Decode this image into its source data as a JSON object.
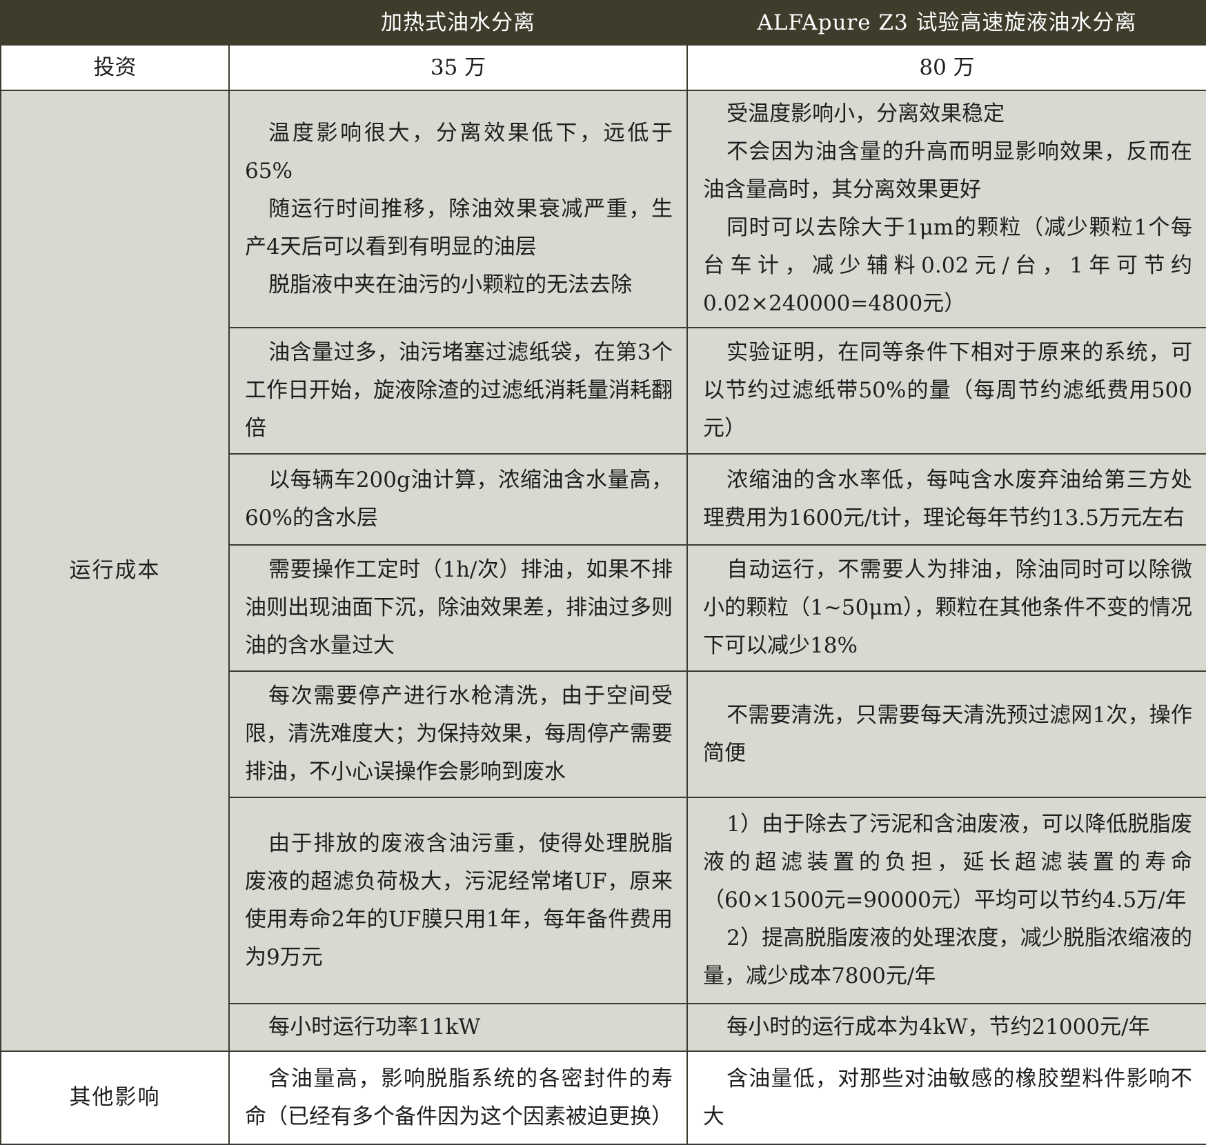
{
  "header": {
    "col0": "",
    "col1": "加热式油水分离",
    "col2": "ALFApure Z3 试验高速旋液油水分离"
  },
  "invest": {
    "label": "投资",
    "col1": "35 万",
    "col2": "80 万"
  },
  "run_cost_label": "运行成本",
  "rows": [
    {
      "left": [
        "温度影响很大，分离效果低下，远低于65%",
        "随运行时间推移，除油效果衰减严重，生产4天后可以看到有明显的油层",
        "脱脂液中夹在油污的小颗粒的无法去除"
      ],
      "right": [
        "受温度影响小，分离效果稳定",
        "不会因为油含量的升高而明显影响效果，反而在油含量高时，其分离效果更好",
        "同时可以去除大于1μm的颗粒（减少颗粒1个每台车计，减少辅料0.02元/台，1年可节约0.02×240000=4800元）"
      ]
    },
    {
      "left": [
        "油含量过多，油污堵塞过滤纸袋，在第3个工作日开始，旋液除渣的过滤纸消耗量消耗翻倍"
      ],
      "right": [
        "实验证明，在同等条件下相对于原来的系统，可以节约过滤纸带50%的量（每周节约滤纸费用500元）"
      ]
    },
    {
      "left": [
        "以每辆车200g油计算，浓缩油含水量高，60%的含水层"
      ],
      "right": [
        "浓缩油的含水率低，每吨含水废弃油给第三方处理费用为1600元/t计，理论每年节约13.5万元左右"
      ]
    },
    {
      "left": [
        "需要操作工定时（1h/次）排油，如果不排油则出现油面下沉，除油效果差，排油过多则油的含水量过大"
      ],
      "right": [
        "自动运行，不需要人为排油，除油同时可以除微小的颗粒（1~50μm），颗粒在其他条件不变的情况下可以减少18%"
      ]
    },
    {
      "left": [
        "每次需要停产进行水枪清洗，由于空间受限，清洗难度大；为保持效果，每周停产需要排油，不小心误操作会影响到废水"
      ],
      "right": [
        "不需要清洗，只需要每天清洗预过滤网1次，操作简便"
      ]
    },
    {
      "left": [
        "由于排放的废液含油污重，使得处理脱脂废液的超滤负荷极大，污泥经常堵UF，原来使用寿命2年的UF膜只用1年，每年备件费用为9万元"
      ],
      "right": [
        "1）由于除去了污泥和含油废液，可以降低脱脂废液的超滤装置的负担，延长超滤装置的寿命（60×1500元=90000元）平均可以节约4.5万/年",
        "2）提高脱脂废液的处理浓度，减少脱脂浓缩液的量，减少成本7800元/年"
      ]
    },
    {
      "left": [
        "每小时运行功率11kW"
      ],
      "right": [
        "每小时的运行成本为4kW，节约21000元/年"
      ]
    }
  ],
  "other": {
    "label": "其他影响",
    "left": [
      "含油量高，影响脱脂系统的各密封件的寿命（已经有多个备件因为这个因素被迫更换）"
    ],
    "right": [
      "含油量低，对那些对油敏感的橡胶塑料件影响不大"
    ]
  }
}
